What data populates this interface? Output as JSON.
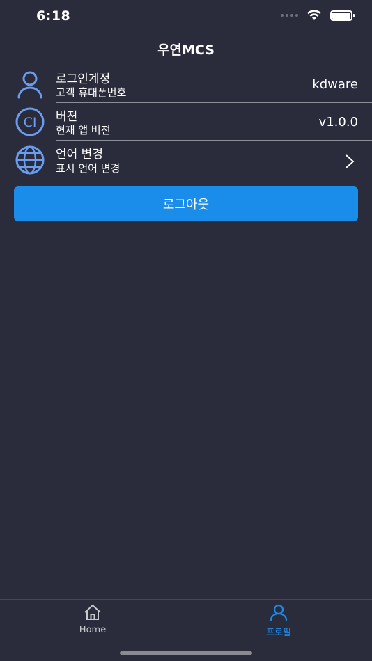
{
  "status_bar": {
    "time": "6:18"
  },
  "header": {
    "title": "우연MCS"
  },
  "rows": [
    {
      "icon": "user-icon",
      "title": "로그인계정",
      "subtitle": "고객 휴대폰번호",
      "value": "kdware"
    },
    {
      "icon": "ci-icon",
      "title": "버젼",
      "subtitle": "현재 앱 버젼",
      "value": "v1.0.0"
    },
    {
      "icon": "globe-icon",
      "title": "언어 변경",
      "subtitle": "표시 언어 변경",
      "value": ""
    }
  ],
  "logout_button": {
    "label": "로그아웃"
  },
  "tab_bar": {
    "tabs": [
      {
        "icon": "home-icon",
        "label": "Home",
        "active": false
      },
      {
        "icon": "profile-icon",
        "label": "프로필",
        "active": true
      }
    ]
  },
  "colors": {
    "background": "#2a2c3b",
    "accent": "#1a8cea",
    "icon_blue": "#6a9cf0",
    "divider": "#8c8e99",
    "inactive_tab": "#c8c9cf"
  }
}
